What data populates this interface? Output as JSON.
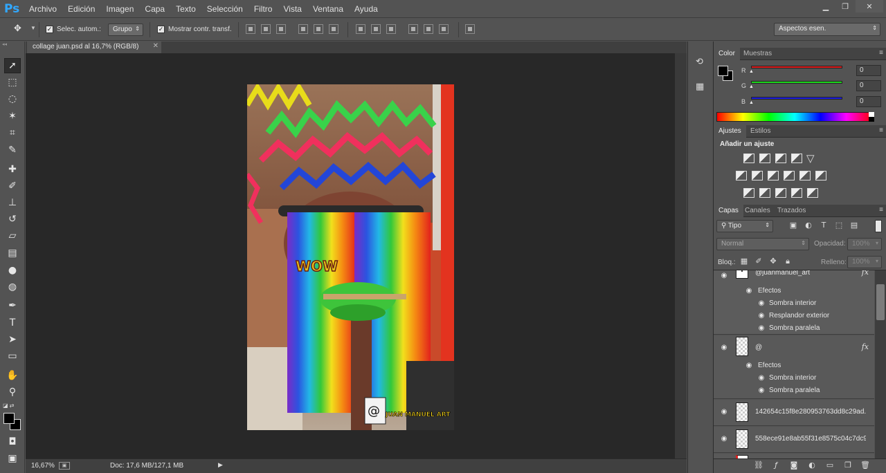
{
  "app": {
    "logo": "Ps",
    "menu": [
      "Archivo",
      "Edición",
      "Imagen",
      "Capa",
      "Texto",
      "Selección",
      "Filtro",
      "Vista",
      "Ventana",
      "Ayuda"
    ]
  },
  "options_bar": {
    "auto_select_label": "Selec. autom.:",
    "auto_select_target": "Grupo",
    "show_transform_label": "Mostrar contr. transf.",
    "workspace": "Aspectos esen."
  },
  "document": {
    "tab_title": "collage juan.psd al 16,7% (RGB/8)",
    "zoom": "16,67%",
    "doc_size": "Doc: 17,6 MB/127,1 MB",
    "artwork_text_wow": "WOW",
    "artwork_signature": "@",
    "artwork_handle": "JUAN MANUEL ART"
  },
  "color_panel": {
    "tabs": [
      "Color",
      "Muestras"
    ],
    "channels": [
      {
        "label": "R",
        "value": "0",
        "color": "#e01b1b"
      },
      {
        "label": "G",
        "value": "0",
        "color": "#1bd61b"
      },
      {
        "label": "B",
        "value": "0",
        "color": "#1b1be0"
      }
    ]
  },
  "adjustments_panel": {
    "tabs": [
      "Ajustes",
      "Estilos"
    ],
    "title": "Añadir un ajuste"
  },
  "layers_panel": {
    "tabs": [
      "Capas",
      "Canales",
      "Trazados"
    ],
    "filter_kind": "Tipo",
    "blend_mode": "Normal",
    "opacity_label": "Opacidad:",
    "opacity_value": "100%",
    "lock_label": "Bloq.:",
    "fill_label": "Relleno:",
    "fill_value": "100%",
    "layers": [
      {
        "name": "@juanmanuel_art",
        "fx": "fx",
        "effects_label": "Efectos",
        "effects": [
          "Sombra interior",
          "Resplandor exterior",
          "Sombra paralela"
        ]
      },
      {
        "name": "@",
        "fx": "fx",
        "effects_label": "Efectos",
        "effects": [
          "Sombra interior",
          "Sombra paralela"
        ]
      },
      {
        "name": "142654c15f8e280953763dd8c29ad..."
      },
      {
        "name": "558ece91e8ab55f31e8575c04c7dc9..."
      }
    ]
  }
}
